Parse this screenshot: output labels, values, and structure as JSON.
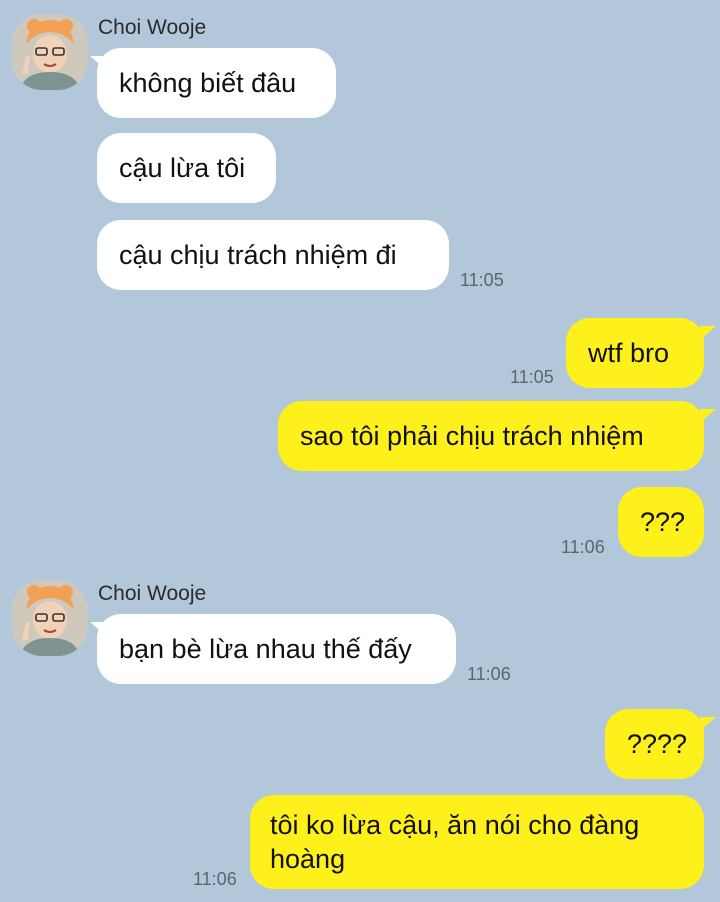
{
  "conversation": {
    "group1": {
      "sender": "Choi Wooje",
      "messages": [
        "không biết đâu",
        "cậu lừa tôi",
        "cậu chịu trách nhiệm đi"
      ],
      "time": "11:05"
    },
    "mine1": {
      "message": "wtf bro",
      "time": "11:05"
    },
    "mine2": {
      "messages": [
        "sao tôi phải chịu trách nhiệm",
        "???"
      ],
      "time": "11:06"
    },
    "group2": {
      "sender": "Choi Wooje",
      "message": "bạn bè lừa nhau thế đấy",
      "time": "11:06"
    },
    "mine3": {
      "messages": [
        "????",
        "tôi ko lừa cậu, ăn nói cho đàng hoàng"
      ],
      "time": "11:06"
    }
  },
  "colors": {
    "background": "#b2c7da",
    "incoming_bubble": "#ffffff",
    "outgoing_bubble": "#fef01b"
  },
  "icons": {
    "avatar": "profile-photo"
  }
}
